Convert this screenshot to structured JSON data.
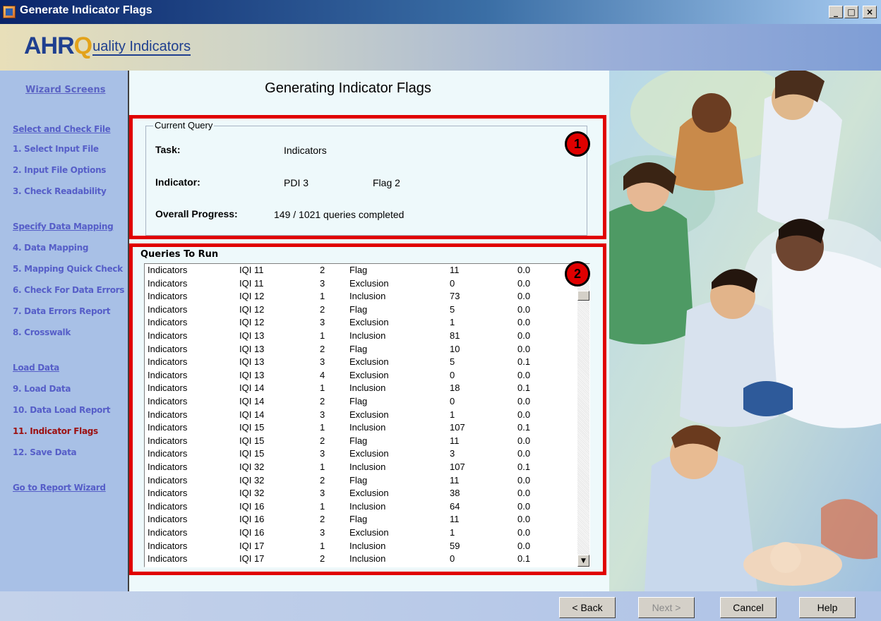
{
  "window": {
    "title": "Generate Indicator Flags",
    "minimize": "_",
    "maximize": "□",
    "close": "×"
  },
  "banner": {
    "logo_ahr": "AHR",
    "logo_q": "Q",
    "logo_rest": "uality Indicators"
  },
  "sidebar": {
    "heading": "Wizard Screens",
    "items": [
      {
        "label": "Select and Check File",
        "type": "section"
      },
      {
        "label": "1. Select Input File",
        "type": "item"
      },
      {
        "label": "2. Input File Options",
        "type": "item"
      },
      {
        "label": "3. Check Readability",
        "type": "item"
      },
      {
        "label": "Specify Data Mapping",
        "type": "section"
      },
      {
        "label": "4. Data Mapping",
        "type": "item"
      },
      {
        "label": "5. Mapping Quick Check",
        "type": "item"
      },
      {
        "label": "6. Check For Data Errors",
        "type": "item"
      },
      {
        "label": "7. Data Errors Report",
        "type": "item"
      },
      {
        "label": "8. Crosswalk",
        "type": "item"
      },
      {
        "label": "Load Data",
        "type": "section"
      },
      {
        "label": "9. Load Data",
        "type": "item"
      },
      {
        "label": "10. Data Load Report",
        "type": "item"
      },
      {
        "label": "11. Indicator Flags",
        "type": "current"
      },
      {
        "label": "12. Save Data",
        "type": "item"
      },
      {
        "label": "Go to Report Wizard",
        "type": "section"
      }
    ]
  },
  "main": {
    "title": "Generating Indicator Flags",
    "current_query": {
      "group_title": "Current Query",
      "task_label": "Task:",
      "task_value": "Indicators",
      "indicator_label": "Indicator:",
      "indicator_value": "PDI 3",
      "flag_value": "Flag 2",
      "progress_label": "Overall Progress:",
      "progress_value": "149 / 1021 queries completed"
    },
    "queries": {
      "heading": "Queries To Run",
      "rows": [
        [
          "Indicators",
          "IQI 11",
          "2",
          "Flag",
          "11",
          "0.0"
        ],
        [
          "Indicators",
          "IQI 11",
          "3",
          "Exclusion",
          "0",
          "0.0"
        ],
        [
          "Indicators",
          "IQI 12",
          "1",
          "Inclusion",
          "73",
          "0.0"
        ],
        [
          "Indicators",
          "IQI 12",
          "2",
          "Flag",
          "5",
          "0.0"
        ],
        [
          "Indicators",
          "IQI 12",
          "3",
          "Exclusion",
          "1",
          "0.0"
        ],
        [
          "Indicators",
          "IQI 13",
          "1",
          "Inclusion",
          "81",
          "0.0"
        ],
        [
          "Indicators",
          "IQI 13",
          "2",
          "Flag",
          "10",
          "0.0"
        ],
        [
          "Indicators",
          "IQI 13",
          "3",
          "Exclusion",
          "5",
          "0.1"
        ],
        [
          "Indicators",
          "IQI 13",
          "4",
          "Exclusion",
          "0",
          "0.0"
        ],
        [
          "Indicators",
          "IQI 14",
          "1",
          "Inclusion",
          "18",
          "0.1"
        ],
        [
          "Indicators",
          "IQI 14",
          "2",
          "Flag",
          "0",
          "0.0"
        ],
        [
          "Indicators",
          "IQI 14",
          "3",
          "Exclusion",
          "1",
          "0.0"
        ],
        [
          "Indicators",
          "IQI 15",
          "1",
          "Inclusion",
          "107",
          "0.1"
        ],
        [
          "Indicators",
          "IQI 15",
          "2",
          "Flag",
          "11",
          "0.0"
        ],
        [
          "Indicators",
          "IQI 15",
          "3",
          "Exclusion",
          "3",
          "0.0"
        ],
        [
          "Indicators",
          "IQI 32",
          "1",
          "Inclusion",
          "107",
          "0.1"
        ],
        [
          "Indicators",
          "IQI 32",
          "2",
          "Flag",
          "11",
          "0.0"
        ],
        [
          "Indicators",
          "IQI 32",
          "3",
          "Exclusion",
          "38",
          "0.0"
        ],
        [
          "Indicators",
          "IQI 16",
          "1",
          "Inclusion",
          "64",
          "0.0"
        ],
        [
          "Indicators",
          "IQI 16",
          "2",
          "Flag",
          "11",
          "0.0"
        ],
        [
          "Indicators",
          "IQI 16",
          "3",
          "Exclusion",
          "1",
          "0.0"
        ],
        [
          "Indicators",
          "IQI 17",
          "1",
          "Inclusion",
          "59",
          "0.0"
        ],
        [
          "Indicators",
          "IQI 17",
          "2",
          "Inclusion",
          "0",
          "0.1"
        ]
      ]
    }
  },
  "annotations": {
    "badge1": "1",
    "badge2": "2"
  },
  "footer": {
    "back": "< Back",
    "next": "Next >",
    "cancel": "Cancel",
    "help": "Help"
  },
  "colors": {
    "sidebar_link": "#565ec8",
    "sidebar_current": "#9c1010",
    "annotation_red": "#e00000"
  }
}
